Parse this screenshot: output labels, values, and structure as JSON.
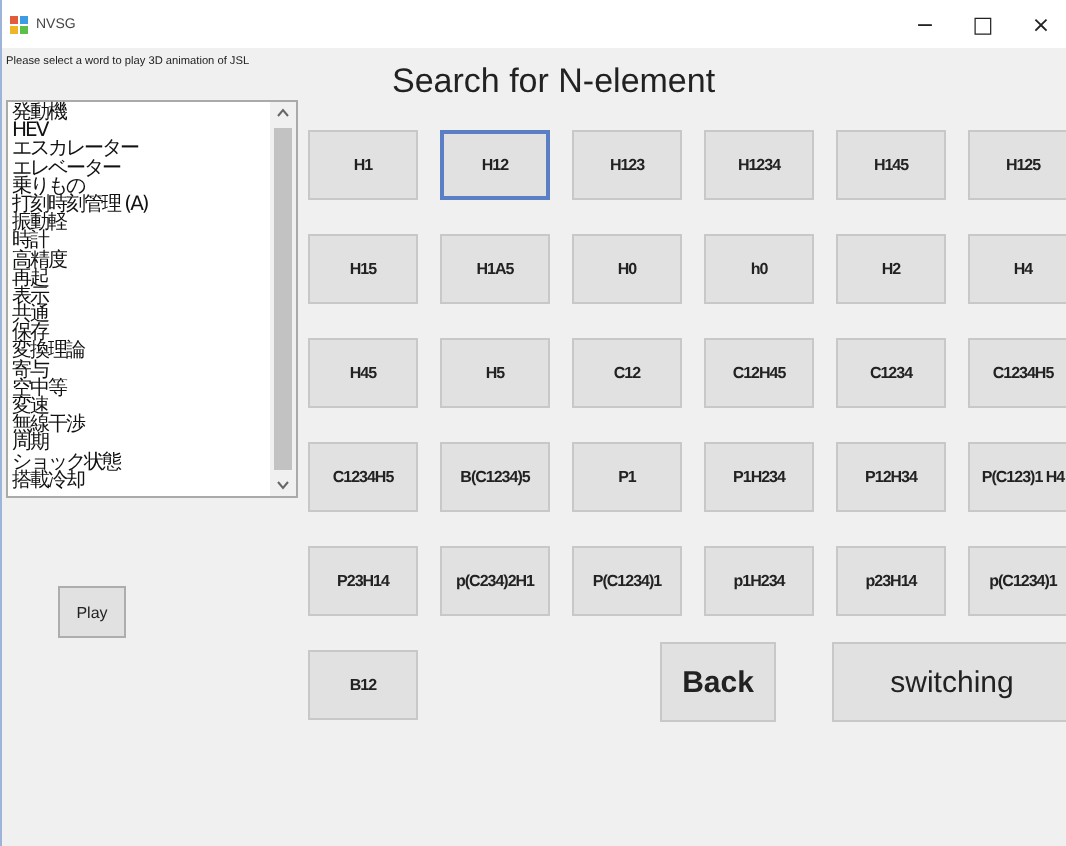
{
  "window": {
    "title": "NVSG",
    "controls": [
      "−",
      "□",
      "×"
    ]
  },
  "prompt": "Please select a word to play 3D animation of JSL",
  "word_list": [
    "発動機",
    "HEV",
    "エスカレーター",
    "エレベーター",
    "乗りもの",
    "打刻時刻管理 (A)",
    "振動軽",
    "時計",
    "高精度",
    "再起",
    "表示",
    "共通",
    "保存",
    "変換理論",
    "寄与",
    "空中等",
    "変速",
    "無線干渉",
    "周期",
    "ショック状態",
    "搭載冷却"
  ],
  "play_button": "Play",
  "heading": "Search for N-element",
  "element_buttons": [
    {
      "label": "H1",
      "selected": false
    },
    {
      "label": "H12",
      "selected": true
    },
    {
      "label": "H123",
      "selected": false
    },
    {
      "label": "H1234",
      "selected": false
    },
    {
      "label": "H145",
      "selected": false
    },
    {
      "label": "H125",
      "selected": false
    },
    {
      "label": "H15",
      "selected": false
    },
    {
      "label": "H1A5",
      "selected": false
    },
    {
      "label": "H0",
      "selected": false
    },
    {
      "label": "h0",
      "selected": false
    },
    {
      "label": "H2",
      "selected": false
    },
    {
      "label": "H4",
      "selected": false
    },
    {
      "label": "H45",
      "selected": false
    },
    {
      "label": "H5",
      "selected": false
    },
    {
      "label": "C12",
      "selected": false
    },
    {
      "label": "C12H45",
      "selected": false
    },
    {
      "label": "C1234",
      "selected": false
    },
    {
      "label": "C1234H5",
      "selected": false
    },
    {
      "label": "C1234H5",
      "selected": false
    },
    {
      "label": "B(C1234)5",
      "selected": false
    },
    {
      "label": "P1",
      "selected": false
    },
    {
      "label": "P1H234",
      "selected": false
    },
    {
      "label": "P12H34",
      "selected": false
    },
    {
      "label": "P(C123)1 H4",
      "selected": false
    },
    {
      "label": "P23H14",
      "selected": false
    },
    {
      "label": "p(C234)2H1",
      "selected": false
    },
    {
      "label": "P(C1234)1",
      "selected": false
    },
    {
      "label": "p1H234",
      "selected": false
    },
    {
      "label": "p23H14",
      "selected": false
    },
    {
      "label": "p(C1234)1",
      "selected": false
    },
    {
      "label": "B12",
      "selected": false
    }
  ],
  "back_button": "Back",
  "switch_button": "switching"
}
